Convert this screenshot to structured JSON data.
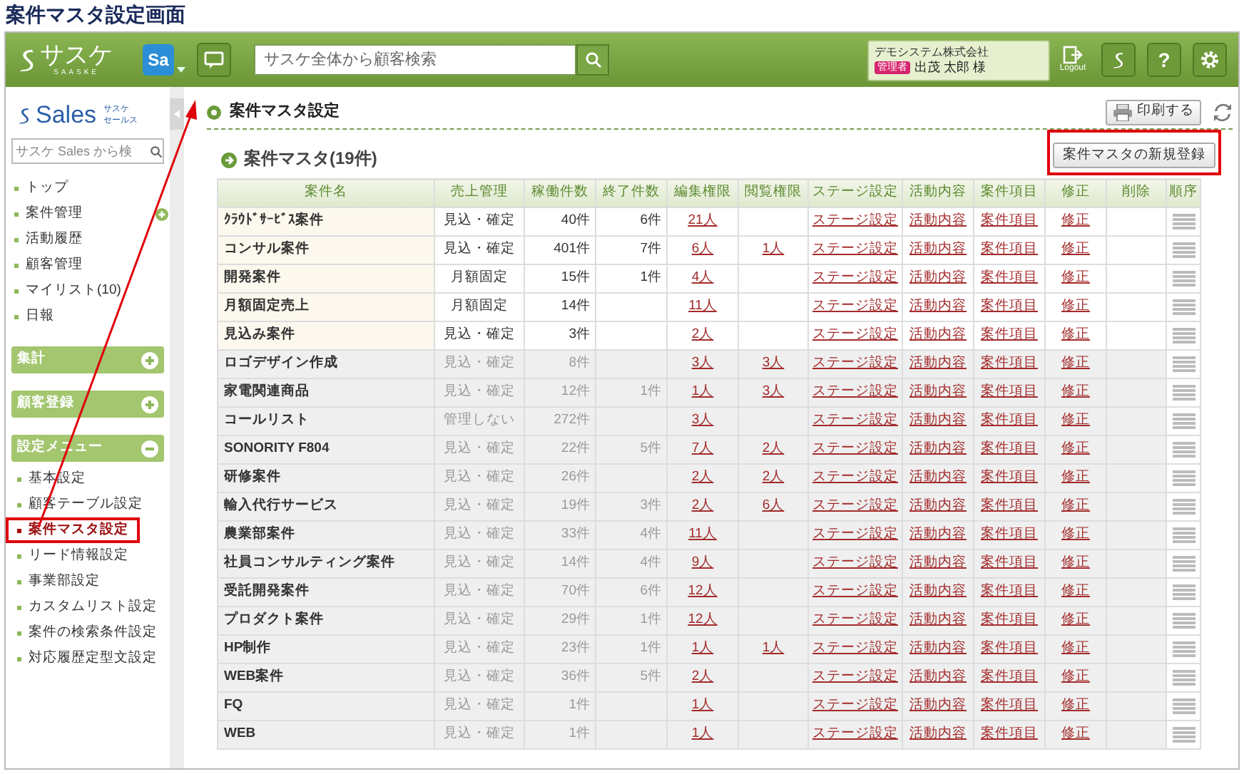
{
  "page_title": "案件マスタ設定画面",
  "header": {
    "logo": "サスケ",
    "logo_sub": "SAASKE",
    "app_badge": "Sa",
    "search": {
      "placeholder": "サスケ全体から顧客検索"
    },
    "user": {
      "company": "デモシステム株式会社",
      "role": "管理者",
      "name": "出茂 太郎 様"
    },
    "logout": "Logout",
    "help": "?"
  },
  "sidebar": {
    "logo": "Sales",
    "logo_sub": [
      "サスケ",
      "セールス"
    ],
    "search": {
      "placeholder": "サスケ Sales から検"
    },
    "items": [
      {
        "label": "トップ",
        "expandable": false
      },
      {
        "label": "案件管理",
        "expandable": true
      },
      {
        "label": "活動履歴",
        "expandable": false
      },
      {
        "label": "顧客管理",
        "expandable": false
      },
      {
        "label": "マイリスト(10)",
        "expandable": false
      },
      {
        "label": "日報",
        "expandable": false
      }
    ],
    "sections": [
      {
        "label": "集計",
        "expanded": false
      },
      {
        "label": "顧客登録",
        "expanded": false
      },
      {
        "label": "設定メニュー",
        "expanded": true,
        "items": [
          {
            "label": "基本設定",
            "selected": false,
            "highlighted": false
          },
          {
            "label": "顧客テーブル設定",
            "selected": false,
            "highlighted": false
          },
          {
            "label": "案件マスタ設定",
            "selected": true,
            "highlighted": true
          },
          {
            "label": "リード情報設定",
            "selected": false,
            "highlighted": false
          },
          {
            "label": "事業部設定",
            "selected": false,
            "highlighted": false
          },
          {
            "label": "カスタムリスト設定",
            "selected": false,
            "highlighted": false
          },
          {
            "label": "案件の検索条件設定",
            "selected": false,
            "highlighted": false
          },
          {
            "label": "対応履歴定型文設定",
            "selected": false,
            "highlighted": false
          }
        ]
      }
    ]
  },
  "main": {
    "title": "案件マスタ設定",
    "print": "印刷する",
    "list_title": "案件マスタ(19件)",
    "new_button": {
      "label": "案件マスタの新規登録",
      "highlighted": true
    },
    "annotation_arrow": true,
    "table": {
      "columns": [
        "案件名",
        "売上管理",
        "稼働件数",
        "終了件数",
        "編集権限",
        "閲覧権限",
        "ステージ設定",
        "活動内容",
        "案件項目",
        "修正",
        "削除",
        "順序"
      ],
      "rows": [
        {
          "name": "ｸﾗｳﾄﾞｻｰﾋﾞｽ案件",
          "sales": "見込・確定",
          "running": "40件",
          "ended": "6件",
          "edit": "21人",
          "stage": "ステージ設定",
          "activity": "活動内容",
          "fields": "案件項目",
          "modify": "修正",
          "active": true
        },
        {
          "name": "コンサル案件",
          "sales": "見込・確定",
          "running": "401件",
          "ended": "7件",
          "edit": "6人",
          "view": "1人",
          "stage": "ステージ設定",
          "activity": "活動内容",
          "fields": "案件項目",
          "modify": "修正",
          "active": true
        },
        {
          "name": "開発案件",
          "sales": "月額固定",
          "running": "15件",
          "ended": "1件",
          "edit": "4人",
          "stage": "ステージ設定",
          "activity": "活動内容",
          "fields": "案件項目",
          "modify": "修正",
          "active": true
        },
        {
          "name": "月額固定売上",
          "sales": "月額固定",
          "running": "14件",
          "edit": "11人",
          "stage": "ステージ設定",
          "activity": "活動内容",
          "fields": "案件項目",
          "modify": "修正",
          "active": true
        },
        {
          "name": "見込み案件",
          "sales": "見込・確定",
          "running": "3件",
          "edit": "2人",
          "stage": "ステージ設定",
          "activity": "活動内容",
          "fields": "案件項目",
          "modify": "修正",
          "active": true
        },
        {
          "name": "ロゴデザイン作成",
          "sales": "見込・確定",
          "running": "8件",
          "edit": "3人",
          "view": "3人",
          "stage": "ステージ設定",
          "activity": "活動内容",
          "fields": "案件項目",
          "modify": "修正",
          "active": false
        },
        {
          "name": "家電関連商品",
          "sales": "見込・確定",
          "running": "12件",
          "ended": "1件",
          "edit": "1人",
          "view": "3人",
          "stage": "ステージ設定",
          "activity": "活動内容",
          "fields": "案件項目",
          "modify": "修正",
          "active": false
        },
        {
          "name": "コールリスト",
          "sales": "管理しない",
          "running": "272件",
          "edit": "3人",
          "stage": "ステージ設定",
          "activity": "活動内容",
          "fields": "案件項目",
          "modify": "修正",
          "active": false
        },
        {
          "name": "SONORITY F804",
          "sales": "見込・確定",
          "running": "22件",
          "ended": "5件",
          "edit": "7人",
          "view": "2人",
          "stage": "ステージ設定",
          "activity": "活動内容",
          "fields": "案件項目",
          "modify": "修正",
          "active": false
        },
        {
          "name": "研修案件",
          "sales": "見込・確定",
          "running": "26件",
          "edit": "2人",
          "view": "2人",
          "stage": "ステージ設定",
          "activity": "活動内容",
          "fields": "案件項目",
          "modify": "修正",
          "active": false
        },
        {
          "name": "輸入代行サービス",
          "sales": "見込・確定",
          "running": "19件",
          "ended": "3件",
          "edit": "2人",
          "view": "6人",
          "stage": "ステージ設定",
          "activity": "活動内容",
          "fields": "案件項目",
          "modify": "修正",
          "active": false
        },
        {
          "name": "農業部案件",
          "sales": "見込・確定",
          "running": "33件",
          "ended": "4件",
          "edit": "11人",
          "stage": "ステージ設定",
          "activity": "活動内容",
          "fields": "案件項目",
          "modify": "修正",
          "active": false
        },
        {
          "name": "社員コンサルティング案件",
          "sales": "見込・確定",
          "running": "14件",
          "ended": "4件",
          "edit": "9人",
          "stage": "ステージ設定",
          "activity": "活動内容",
          "fields": "案件項目",
          "modify": "修正",
          "active": false
        },
        {
          "name": "受託開発案件",
          "sales": "見込・確定",
          "running": "70件",
          "ended": "6件",
          "edit": "12人",
          "stage": "ステージ設定",
          "activity": "活動内容",
          "fields": "案件項目",
          "modify": "修正",
          "active": false
        },
        {
          "name": "プロダクト案件",
          "sales": "見込・確定",
          "running": "29件",
          "ended": "1件",
          "edit": "12人",
          "stage": "ステージ設定",
          "activity": "活動内容",
          "fields": "案件項目",
          "modify": "修正",
          "active": false
        },
        {
          "name": "HP制作",
          "sales": "見込・確定",
          "running": "23件",
          "ended": "1件",
          "edit": "1人",
          "view": "1人",
          "stage": "ステージ設定",
          "activity": "活動内容",
          "fields": "案件項目",
          "modify": "修正",
          "active": false
        },
        {
          "name": "WEB案件",
          "sales": "見込・確定",
          "running": "36件",
          "ended": "5件",
          "edit": "2人",
          "stage": "ステージ設定",
          "activity": "活動内容",
          "fields": "案件項目",
          "modify": "修正",
          "active": false
        },
        {
          "name": "FQ",
          "sales": "見込・確定",
          "running": "1件",
          "edit": "1人",
          "stage": "ステージ設定",
          "activity": "活動内容",
          "fields": "案件項目",
          "modify": "修正",
          "active": false
        },
        {
          "name": "WEB",
          "sales": "見込・確定",
          "running": "1件",
          "edit": "1人",
          "stage": "ステージ設定",
          "activity": "活動内容",
          "fields": "案件項目",
          "modify": "修正",
          "active": false
        }
      ]
    }
  }
}
